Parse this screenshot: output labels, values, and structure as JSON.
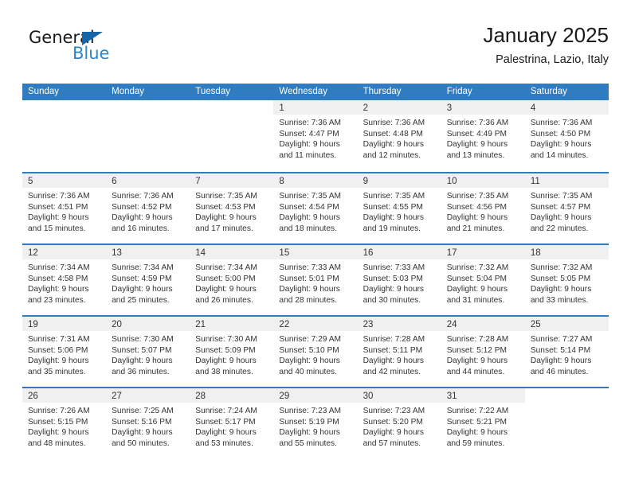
{
  "brand": {
    "name_part1": "General",
    "name_part2": "Blue",
    "logo_icon": "blue-triangle-flag-icon"
  },
  "header": {
    "title": "January 2025",
    "location": "Palestrina, Lazio, Italy"
  },
  "colors": {
    "header_blue": "#2f7cc0",
    "brand_blue": "#2e86c8",
    "logo_triangle": "#1565a8",
    "daynum_band": "#f0f0f0",
    "text": "#333333"
  },
  "weekdays": [
    "Sunday",
    "Monday",
    "Tuesday",
    "Wednesday",
    "Thursday",
    "Friday",
    "Saturday"
  ],
  "weeks": [
    [
      {
        "empty": true
      },
      {
        "empty": true
      },
      {
        "empty": true
      },
      {
        "day": "1",
        "sunrise": "Sunrise: 7:36 AM",
        "sunset": "Sunset: 4:47 PM",
        "daylight1": "Daylight: 9 hours",
        "daylight2": "and 11 minutes."
      },
      {
        "day": "2",
        "sunrise": "Sunrise: 7:36 AM",
        "sunset": "Sunset: 4:48 PM",
        "daylight1": "Daylight: 9 hours",
        "daylight2": "and 12 minutes."
      },
      {
        "day": "3",
        "sunrise": "Sunrise: 7:36 AM",
        "sunset": "Sunset: 4:49 PM",
        "daylight1": "Daylight: 9 hours",
        "daylight2": "and 13 minutes."
      },
      {
        "day": "4",
        "sunrise": "Sunrise: 7:36 AM",
        "sunset": "Sunset: 4:50 PM",
        "daylight1": "Daylight: 9 hours",
        "daylight2": "and 14 minutes."
      }
    ],
    [
      {
        "day": "5",
        "sunrise": "Sunrise: 7:36 AM",
        "sunset": "Sunset: 4:51 PM",
        "daylight1": "Daylight: 9 hours",
        "daylight2": "and 15 minutes."
      },
      {
        "day": "6",
        "sunrise": "Sunrise: 7:36 AM",
        "sunset": "Sunset: 4:52 PM",
        "daylight1": "Daylight: 9 hours",
        "daylight2": "and 16 minutes."
      },
      {
        "day": "7",
        "sunrise": "Sunrise: 7:35 AM",
        "sunset": "Sunset: 4:53 PM",
        "daylight1": "Daylight: 9 hours",
        "daylight2": "and 17 minutes."
      },
      {
        "day": "8",
        "sunrise": "Sunrise: 7:35 AM",
        "sunset": "Sunset: 4:54 PM",
        "daylight1": "Daylight: 9 hours",
        "daylight2": "and 18 minutes."
      },
      {
        "day": "9",
        "sunrise": "Sunrise: 7:35 AM",
        "sunset": "Sunset: 4:55 PM",
        "daylight1": "Daylight: 9 hours",
        "daylight2": "and 19 minutes."
      },
      {
        "day": "10",
        "sunrise": "Sunrise: 7:35 AM",
        "sunset": "Sunset: 4:56 PM",
        "daylight1": "Daylight: 9 hours",
        "daylight2": "and 21 minutes."
      },
      {
        "day": "11",
        "sunrise": "Sunrise: 7:35 AM",
        "sunset": "Sunset: 4:57 PM",
        "daylight1": "Daylight: 9 hours",
        "daylight2": "and 22 minutes."
      }
    ],
    [
      {
        "day": "12",
        "sunrise": "Sunrise: 7:34 AM",
        "sunset": "Sunset: 4:58 PM",
        "daylight1": "Daylight: 9 hours",
        "daylight2": "and 23 minutes."
      },
      {
        "day": "13",
        "sunrise": "Sunrise: 7:34 AM",
        "sunset": "Sunset: 4:59 PM",
        "daylight1": "Daylight: 9 hours",
        "daylight2": "and 25 minutes."
      },
      {
        "day": "14",
        "sunrise": "Sunrise: 7:34 AM",
        "sunset": "Sunset: 5:00 PM",
        "daylight1": "Daylight: 9 hours",
        "daylight2": "and 26 minutes."
      },
      {
        "day": "15",
        "sunrise": "Sunrise: 7:33 AM",
        "sunset": "Sunset: 5:01 PM",
        "daylight1": "Daylight: 9 hours",
        "daylight2": "and 28 minutes."
      },
      {
        "day": "16",
        "sunrise": "Sunrise: 7:33 AM",
        "sunset": "Sunset: 5:03 PM",
        "daylight1": "Daylight: 9 hours",
        "daylight2": "and 30 minutes."
      },
      {
        "day": "17",
        "sunrise": "Sunrise: 7:32 AM",
        "sunset": "Sunset: 5:04 PM",
        "daylight1": "Daylight: 9 hours",
        "daylight2": "and 31 minutes."
      },
      {
        "day": "18",
        "sunrise": "Sunrise: 7:32 AM",
        "sunset": "Sunset: 5:05 PM",
        "daylight1": "Daylight: 9 hours",
        "daylight2": "and 33 minutes."
      }
    ],
    [
      {
        "day": "19",
        "sunrise": "Sunrise: 7:31 AM",
        "sunset": "Sunset: 5:06 PM",
        "daylight1": "Daylight: 9 hours",
        "daylight2": "and 35 minutes."
      },
      {
        "day": "20",
        "sunrise": "Sunrise: 7:30 AM",
        "sunset": "Sunset: 5:07 PM",
        "daylight1": "Daylight: 9 hours",
        "daylight2": "and 36 minutes."
      },
      {
        "day": "21",
        "sunrise": "Sunrise: 7:30 AM",
        "sunset": "Sunset: 5:09 PM",
        "daylight1": "Daylight: 9 hours",
        "daylight2": "and 38 minutes."
      },
      {
        "day": "22",
        "sunrise": "Sunrise: 7:29 AM",
        "sunset": "Sunset: 5:10 PM",
        "daylight1": "Daylight: 9 hours",
        "daylight2": "and 40 minutes."
      },
      {
        "day": "23",
        "sunrise": "Sunrise: 7:28 AM",
        "sunset": "Sunset: 5:11 PM",
        "daylight1": "Daylight: 9 hours",
        "daylight2": "and 42 minutes."
      },
      {
        "day": "24",
        "sunrise": "Sunrise: 7:28 AM",
        "sunset": "Sunset: 5:12 PM",
        "daylight1": "Daylight: 9 hours",
        "daylight2": "and 44 minutes."
      },
      {
        "day": "25",
        "sunrise": "Sunrise: 7:27 AM",
        "sunset": "Sunset: 5:14 PM",
        "daylight1": "Daylight: 9 hours",
        "daylight2": "and 46 minutes."
      }
    ],
    [
      {
        "day": "26",
        "sunrise": "Sunrise: 7:26 AM",
        "sunset": "Sunset: 5:15 PM",
        "daylight1": "Daylight: 9 hours",
        "daylight2": "and 48 minutes."
      },
      {
        "day": "27",
        "sunrise": "Sunrise: 7:25 AM",
        "sunset": "Sunset: 5:16 PM",
        "daylight1": "Daylight: 9 hours",
        "daylight2": "and 50 minutes."
      },
      {
        "day": "28",
        "sunrise": "Sunrise: 7:24 AM",
        "sunset": "Sunset: 5:17 PM",
        "daylight1": "Daylight: 9 hours",
        "daylight2": "and 53 minutes."
      },
      {
        "day": "29",
        "sunrise": "Sunrise: 7:23 AM",
        "sunset": "Sunset: 5:19 PM",
        "daylight1": "Daylight: 9 hours",
        "daylight2": "and 55 minutes."
      },
      {
        "day": "30",
        "sunrise": "Sunrise: 7:23 AM",
        "sunset": "Sunset: 5:20 PM",
        "daylight1": "Daylight: 9 hours",
        "daylight2": "and 57 minutes."
      },
      {
        "day": "31",
        "sunrise": "Sunrise: 7:22 AM",
        "sunset": "Sunset: 5:21 PM",
        "daylight1": "Daylight: 9 hours",
        "daylight2": "and 59 minutes."
      },
      {
        "empty": true
      }
    ]
  ]
}
